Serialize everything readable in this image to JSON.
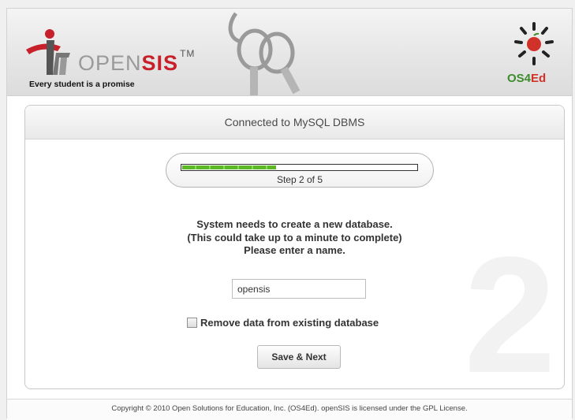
{
  "header": {
    "logo": {
      "name": "OPEN",
      "name_accent": "SIS",
      "trademark": "TM",
      "tagline": "Every student is a promise"
    },
    "brand": {
      "prefix": "OS4",
      "suffix": "Ed"
    },
    "colors": {
      "sis_red": "#c8202a",
      "os4ed_green": "#3e8c2e",
      "ed_red": "#d0322a"
    }
  },
  "panel": {
    "title": "Connected to MySQL DBMS",
    "progress": {
      "label": "Step 2 of 5",
      "fraction": 0.4,
      "color": "#5cb826"
    },
    "message": [
      "System needs to create a new database.",
      "(This could take up to a minute to complete)",
      "Please enter a name."
    ],
    "db_name": {
      "value": "opensis"
    },
    "remove_data_label": "Remove data from existing database",
    "save_label": "Save & Next",
    "watermark": "2"
  },
  "footer": {
    "text": "Copyright © 2010 Open Solutions for Education, Inc. (OS4Ed). openSIS is licensed under the GPL License."
  }
}
